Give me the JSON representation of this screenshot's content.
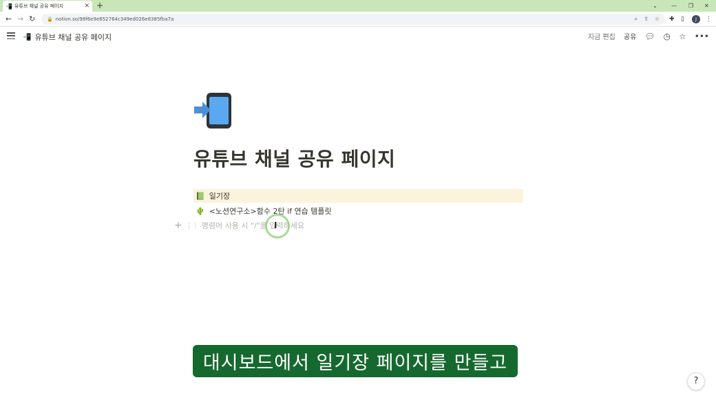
{
  "browser": {
    "tab": {
      "title": "유튜브 채널 공유 페이지",
      "favicon": "phone-arrow-icon"
    },
    "new_tab_label": "+",
    "url": "notion.so/98f6e9e652764c349ed026e8385fba7a",
    "profile_initial": "J"
  },
  "notion": {
    "breadcrumb": "유튜브 채널 공유 페이지",
    "edited_label": "지금 편집",
    "share_label": "공유",
    "page_title": "유튜브 채널 공유 페이지",
    "blocks": [
      {
        "type": "page",
        "icon": "green-book-icon",
        "text": "일기장",
        "highlight": "#fbf3db"
      },
      {
        "type": "page",
        "icon": "cactus-icon",
        "text": "<노션연구소>함수 2탄 if 연습 템플릿"
      }
    ],
    "empty_block_placeholder": "명령어 사용 시 \"/\"를 입력하세요",
    "help_label": "?"
  },
  "overlay": {
    "subtitle": "대시보드에서 일기장 페이지를 만들고",
    "subtitle_bg": "#16692e"
  },
  "colors": {
    "tabbar_bg": "#c8e6b8",
    "callout_bg": "#fbf3db",
    "accent_text": "#37352f"
  }
}
